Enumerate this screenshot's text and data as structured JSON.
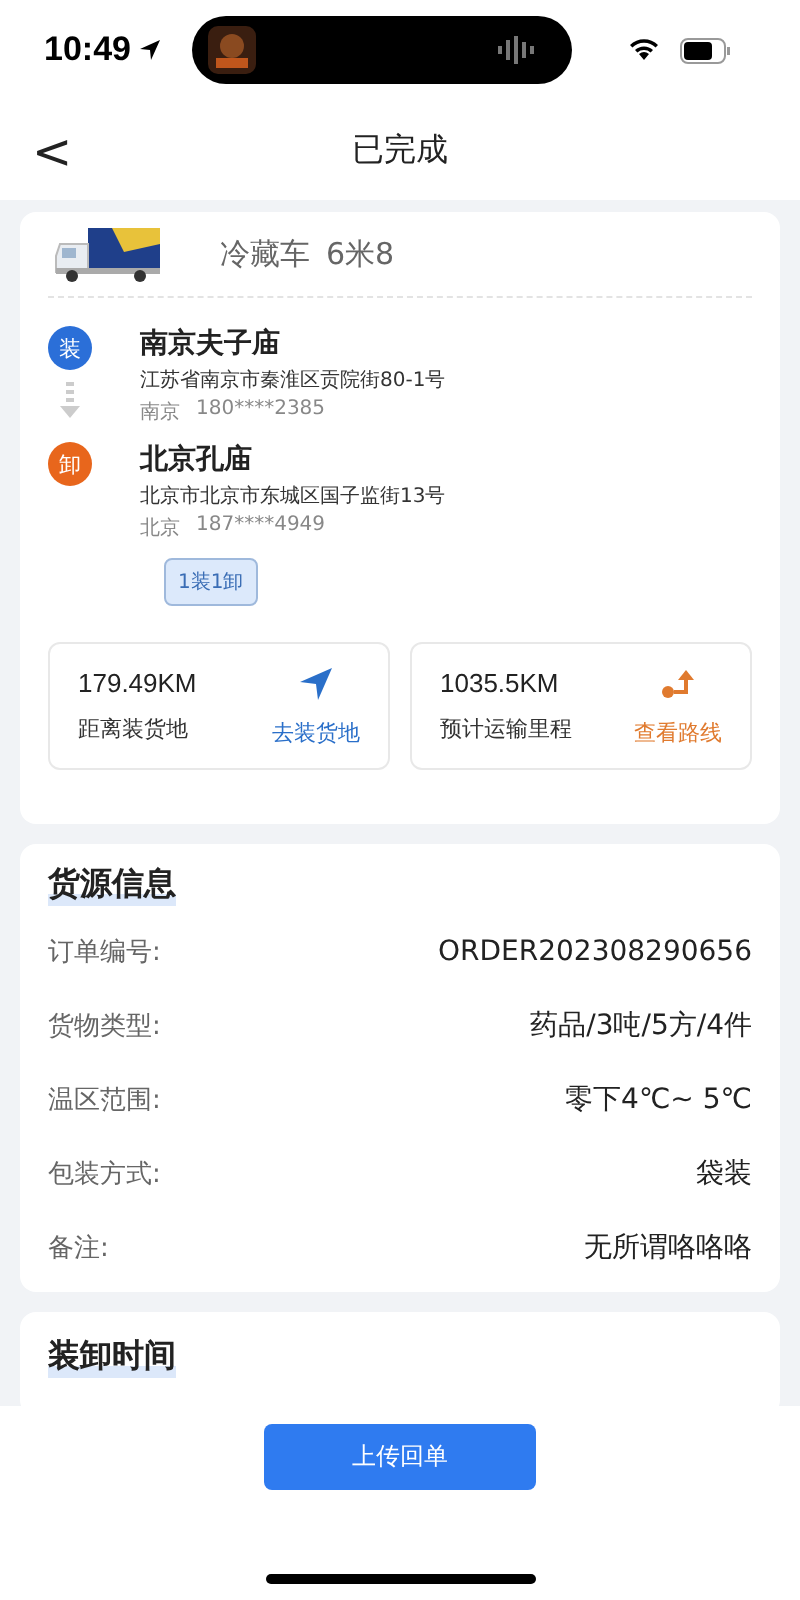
{
  "status_bar": {
    "time": "10:49"
  },
  "nav": {
    "back": "<",
    "title": "已完成"
  },
  "vehicle": {
    "type": "冷藏车",
    "length": "6米8"
  },
  "stops": [
    {
      "kind": "load",
      "badge": "装",
      "name": "南京夫子庙",
      "address": "江苏省南京市秦淮区贡院街80-1号",
      "city": "南京",
      "phone": "180****2385"
    },
    {
      "kind": "unload",
      "badge": "卸",
      "name": "北京孔庙",
      "address": "北京市北京市东城区国子监街13号",
      "city": "北京",
      "phone": "187****4949"
    }
  ],
  "stop_tag": "1装1卸",
  "distances": [
    {
      "kind": "navigate",
      "value": "179.49KM",
      "label": "距离装货地",
      "action": "去装货地"
    },
    {
      "kind": "route",
      "value": "1035.5KM",
      "label": "预计运输里程",
      "action": "查看路线"
    }
  ],
  "cargo": {
    "title": "货源信息",
    "rows": [
      {
        "label": "订单编号:",
        "value": "ORDER202308290656"
      },
      {
        "label": "货物类型:",
        "value": "药品/3吨/5方/4件"
      },
      {
        "label": "温区范围:",
        "value": "零下4℃~ 5℃"
      },
      {
        "label": "包装方式:",
        "value": "袋装"
      },
      {
        "label": "备注:",
        "value": "无所谓咯咯咯"
      }
    ]
  },
  "schedule": {
    "title": "装卸时间"
  },
  "bottom_button": "上传回单"
}
